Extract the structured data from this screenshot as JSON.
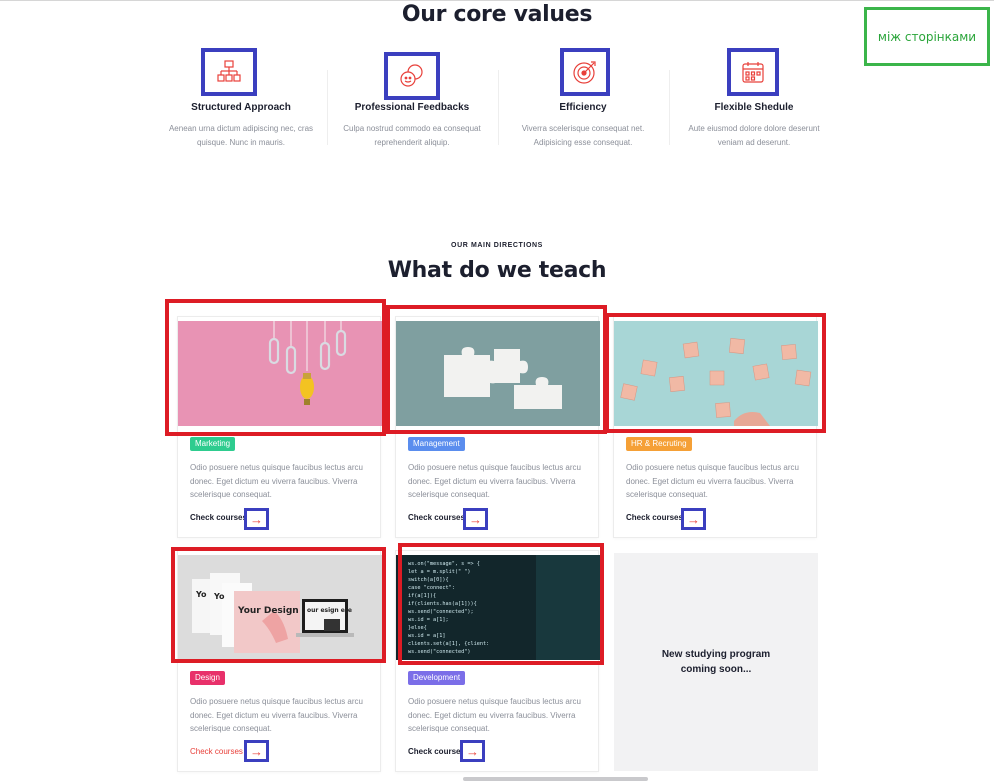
{
  "annotation": {
    "label": "між сторінками"
  },
  "core_values": {
    "title": "Our core values",
    "items": [
      {
        "title": "Structured Approach",
        "text": "Aenean urna dictum adipiscing nec, cras quisque. Nunc in mauris.",
        "icon": "structure-icon"
      },
      {
        "title": "Professional Feedbacks",
        "text": "Culpa nostrud commodo ea consequat reprehenderit aliquip.",
        "icon": "chat-bubbles-icon"
      },
      {
        "title": "Efficiency",
        "text": "Viverra scelerisque consequat net. Adipisicing esse consequat.",
        "icon": "target-icon"
      },
      {
        "title": "Flexible Shedule",
        "text": "Aute eiusmod dolore dolore deserunt veniam ad deserunt.",
        "icon": "calendar-icon"
      }
    ]
  },
  "directions": {
    "eyebrow": "OUR MAIN DIRECTIONS",
    "title": "What do we teach",
    "cards": [
      {
        "tag": "Marketing",
        "tag_color": "#2ecc8f",
        "desc": "Odio posuere netus quisque faucibus lectus arcu donec. Eget dictum eu viverra faucibus. Viverra scelerisque consequat.",
        "link": "Check courses",
        "image": "lightbulb-paperclips-image"
      },
      {
        "tag": "Management",
        "tag_color": "#5a8dee",
        "desc": "Odio posuere netus quisque faucibus lectus arcu donec. Eget dictum eu viverra faucibus. Viverra scelerisque consequat.",
        "link": "Check courses",
        "image": "puzzle-pieces-image"
      },
      {
        "tag": "HR & Recruting",
        "tag_color": "#f5a036",
        "desc": "Odio posuere netus quisque faucibus lectus arcu donec. Eget dictum eu viverra faucibus. Viverra scelerisque consequat.",
        "link": "Check courses",
        "image": "people-blocks-image"
      },
      {
        "tag": "Design",
        "tag_color": "#e8306a",
        "desc": "Odio posuere netus quisque faucibus lectus arcu donec. Eget dictum eu viverra faucibus. Viverra scelerisque consequat.",
        "link": "Check courses",
        "image": "design-mockup-image"
      },
      {
        "tag": "Development",
        "tag_color": "#7b6ee8",
        "desc": "Odio posuere netus quisque faucibus lectus arcu donec. Eget dictum eu viverra faucibus. Viverra scelerisque consequat.",
        "link": "Check courses",
        "image": "code-screen-image"
      }
    ],
    "coming_soon": "New studying program coming soon..."
  },
  "mockup_text": {
    "design": "Your Design Here",
    "laptop": "our esign ere"
  },
  "code_lines": [
    "ws.on(\"message\", s => {",
    "  let a = m.split(\" \")",
    "  switch(a[0]){",
    "    case \"connect\":",
    "      if(a[1]){",
    "        if(clients.has(a[1])){",
    "          ws.send(\"connected\");",
    "          ws.id = a[1];",
    "        }else{",
    "          ws.id = a[1]",
    "          clients.set(a[1], {client:",
    "          ws.send(\"connected\")"
  ]
}
